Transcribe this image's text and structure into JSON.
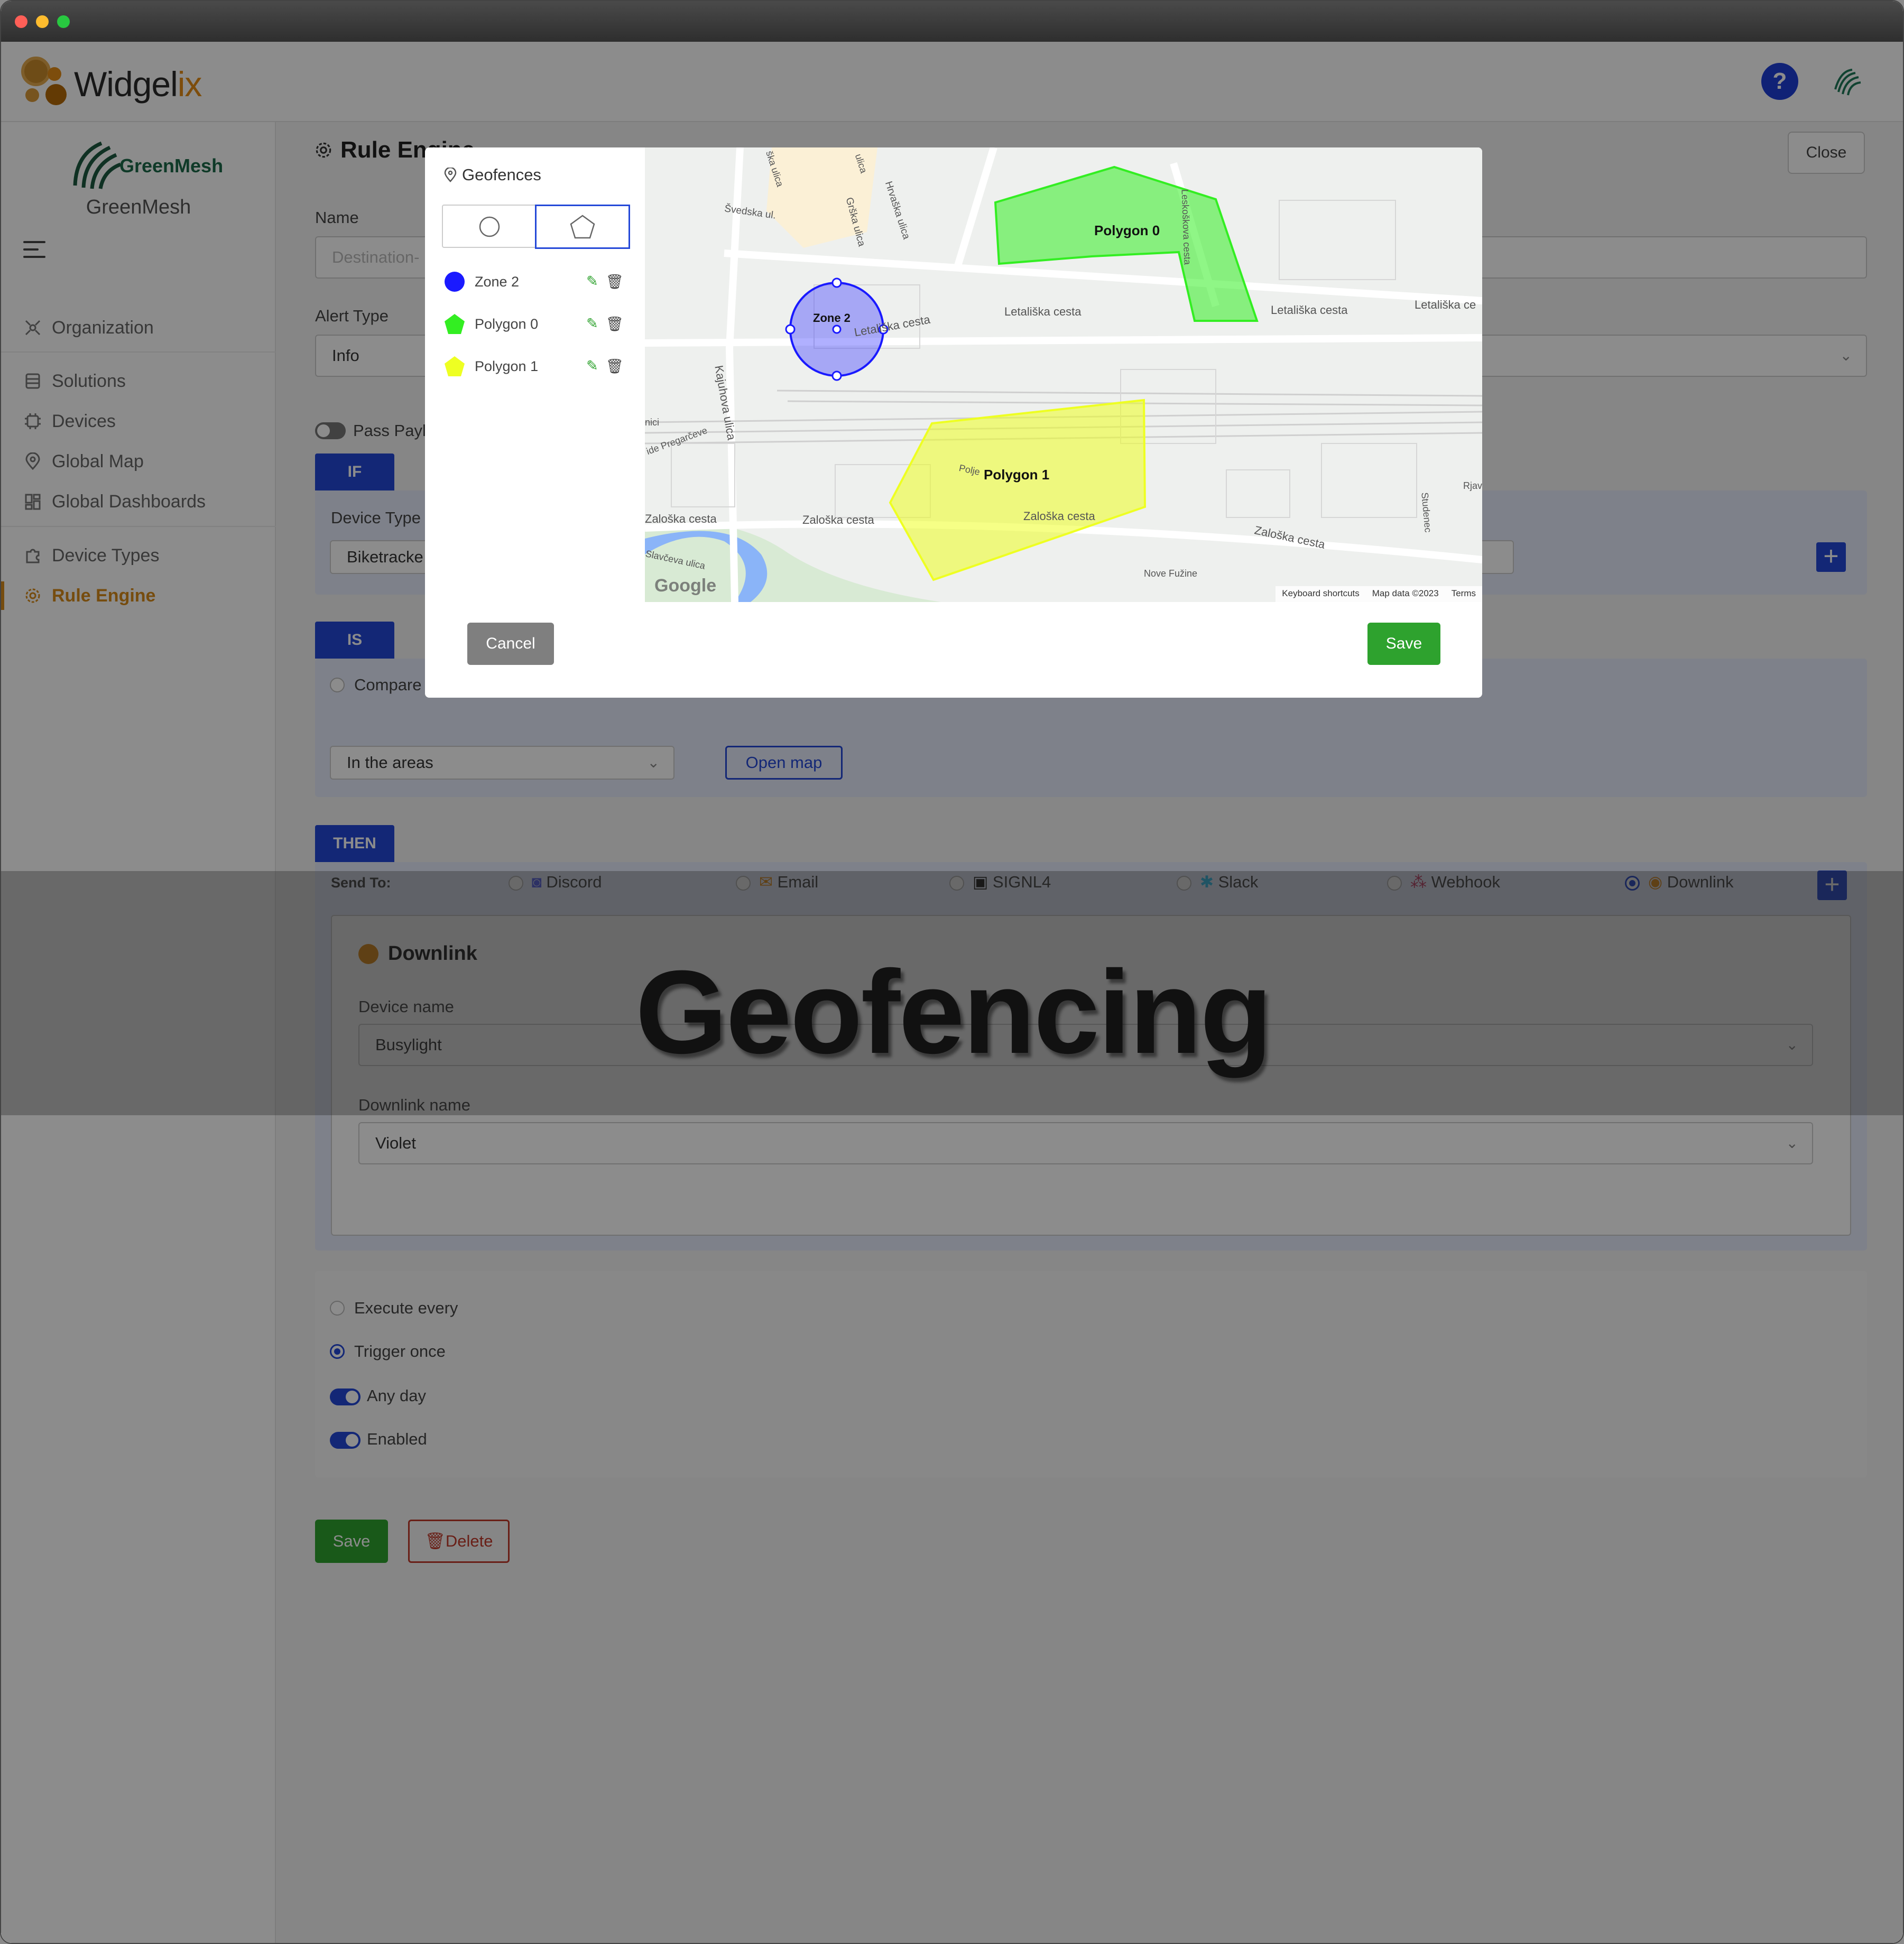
{
  "window": {
    "dots": [
      "#ff5f57",
      "#febc2e",
      "#28c840"
    ]
  },
  "header": {
    "brand": "Widgel",
    "brand_suffix": "ix",
    "help": "?"
  },
  "sidebar": {
    "org_name": "GreenMesh",
    "org_logo_text": "GreenMesh",
    "nav": [
      {
        "label": "Organization",
        "icon": "organization-icon"
      },
      {
        "label": "Solutions",
        "icon": "solutions-icon"
      },
      {
        "label": "Devices",
        "icon": "devices-icon"
      },
      {
        "label": "Global Map",
        "icon": "map-pin-icon"
      },
      {
        "label": "Global Dashboards",
        "icon": "dashboards-icon"
      },
      {
        "label": "Device Types",
        "icon": "puzzle-icon"
      },
      {
        "label": "Rule Engine",
        "icon": "gear-icon",
        "active": true
      }
    ]
  },
  "page": {
    "title": "Rule Engine",
    "close": "Close",
    "name_label": "Name",
    "name_placeholder": "Destination-",
    "alert_label": "Alert Type",
    "alert_value": "Info",
    "pass_payload": "Pass Paylo",
    "if_tag": "IF",
    "device_type_label": "Device Type",
    "device_type_value": "Biketracke",
    "is_tag": "IS",
    "compare_label": "Compare",
    "areas_value": "In the areas",
    "open_map": "Open map",
    "then_tag": "THEN",
    "send_to": "Send To:",
    "channels": [
      "Discord",
      "Email",
      "SIGNL4",
      "Slack",
      "Webhook",
      "Downlink"
    ],
    "selected_channel": "Downlink",
    "downlink_title": "Downlink",
    "device_name_label": "Device name",
    "device_name_value": "Busylight",
    "downlink_name_label": "Downlink name",
    "downlink_name_value": "Violet",
    "execute_every": "Execute every",
    "trigger_once": "Trigger once",
    "any_day": "Any day",
    "enabled": "Enabled",
    "save": "Save",
    "delete": "Delete"
  },
  "modal": {
    "title": "Geofences",
    "zones": [
      {
        "name": "Zone 2",
        "color": "#1a1aff",
        "shape": "circle"
      },
      {
        "name": "Polygon 0",
        "color": "#33ee22",
        "shape": "pentagon"
      },
      {
        "name": "Polygon 1",
        "color": "#eeff22",
        "shape": "pentagon"
      }
    ],
    "cancel": "Cancel",
    "save": "Save",
    "map": {
      "streets": [
        "Švedska ul.",
        "Hrvaška ulica",
        "Grška ulica",
        "Letališka cesta",
        "Letališka cesta",
        "Letališka cesta",
        "Letališka ce",
        "Kajuhova ulica",
        "Zaloška cesta",
        "Zaloška cesta",
        "Zaloška cesta",
        "Zaloška cesta",
        "Nove Fužine",
        "Studenec",
        "Rjav",
        "ide Pregarčeve",
        "Slavčeva ulica",
        "Polje",
        "Leskoškova cesta",
        "ulica",
        "ška ulica",
        "nici"
      ],
      "footer": [
        "Keyboard shortcuts",
        "Map data ©2023",
        "Terms"
      ],
      "google": "Google"
    }
  },
  "banner": "Geofencing"
}
